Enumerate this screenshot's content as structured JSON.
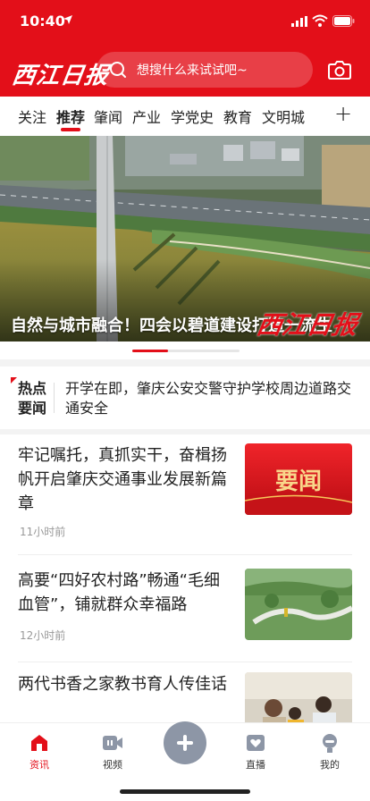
{
  "status_bar": {
    "time": "10:40"
  },
  "header": {
    "brand": "西江日报",
    "search_placeholder": "想搜什么来试试吧~",
    "accent_color": "#e30f19"
  },
  "tabs": [
    {
      "label": "关注",
      "active": false
    },
    {
      "label": "推荐",
      "active": true
    },
    {
      "label": "肇闻",
      "active": false
    },
    {
      "label": "产业",
      "active": false
    },
    {
      "label": "学党史",
      "active": false
    },
    {
      "label": "教育",
      "active": false
    },
    {
      "label": "文明城",
      "active": false
    }
  ],
  "tab_more": "+",
  "banner": {
    "caption": "自然与城市融合！四会以碧道建设打造一流生",
    "logo": "西江日报",
    "slide_index": 1,
    "slide_count": 3
  },
  "hot": {
    "label": "热点要闻",
    "text": "开学在即，肇庆公安交警守护学校周边道路交通安全"
  },
  "news": [
    {
      "title": "牢记嘱托，真抓实干，奋楫扬帆开启肇庆交通事业发展新篇章",
      "time": "11小时前",
      "thumb_text": "要闻",
      "thumb": "red-banner"
    },
    {
      "title": "高要“四好农村路”畅通“毛细血管”，铺就群众幸福路",
      "time": "12小时前",
      "thumb": "green-road"
    },
    {
      "title": "两代书香之家教书育人传佳话",
      "time": "",
      "thumb": "family-reading"
    }
  ],
  "bottom_nav": [
    {
      "label": "资讯",
      "icon": "home-icon",
      "active": true
    },
    {
      "label": "视频",
      "icon": "video-icon",
      "active": false
    },
    {
      "label": "",
      "icon": "plus-icon",
      "active": false
    },
    {
      "label": "直播",
      "icon": "live-icon",
      "active": false
    },
    {
      "label": "我的",
      "icon": "profile-icon",
      "active": false
    }
  ]
}
